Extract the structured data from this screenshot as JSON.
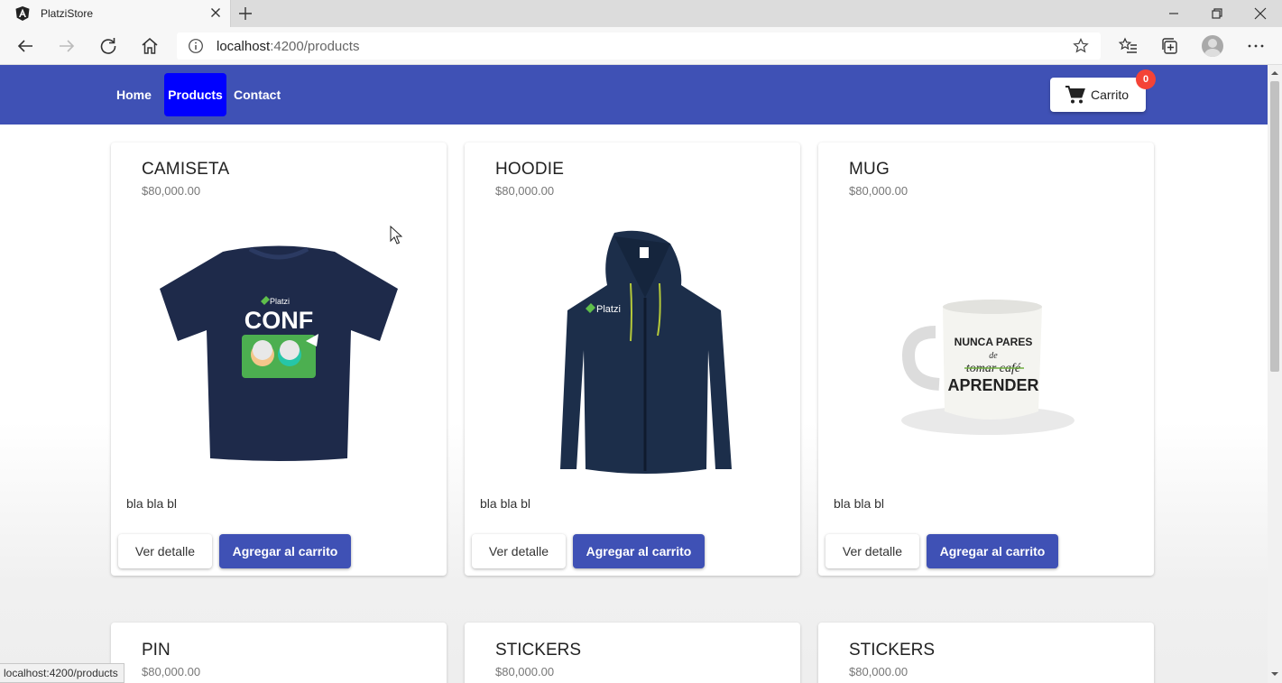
{
  "browser": {
    "tab_title": "PlatziStore",
    "url_host": "localhost",
    "url_rest": ":4200/products",
    "status_url": "localhost:4200/products"
  },
  "nav": {
    "links": [
      {
        "label": "Home",
        "active": false
      },
      {
        "label": "Products",
        "active": true
      },
      {
        "label": "Contact",
        "active": false
      }
    ],
    "cart_label": "Carrito",
    "cart_count": "0"
  },
  "products": [
    {
      "title": "CAMISETA",
      "price": "$80,000.00",
      "description": "bla bla bl",
      "image": "tshirt-image"
    },
    {
      "title": "HOODIE",
      "price": "$80,000.00",
      "description": "bla bla bl",
      "image": "hoodie-image"
    },
    {
      "title": "MUG",
      "price": "$80,000.00",
      "description": "bla bla bl",
      "image": "mug-image"
    }
  ],
  "products_row2": [
    {
      "title": "PIN",
      "price": "$80,000.00"
    },
    {
      "title": "STICKERS",
      "price": "$80,000.00"
    },
    {
      "title": "STICKERS",
      "price": "$80,000.00"
    }
  ],
  "buttons": {
    "detail_label": "Ver detalle",
    "add_label": "Agregar al carrito"
  },
  "images": {
    "tshirt_brand": "Platzi",
    "tshirt_logo": "CONF",
    "hoodie_brand": "Platzi",
    "mug_line1": "NUNCA PARES",
    "mug_line2": "de",
    "mug_line3": "tomar café",
    "mug_line4": "APRENDER"
  },
  "colors": {
    "appbar": "#3f51b5",
    "active_nav": "#0000ff",
    "badge": "#f44336",
    "primary_button": "#3f51b5"
  }
}
